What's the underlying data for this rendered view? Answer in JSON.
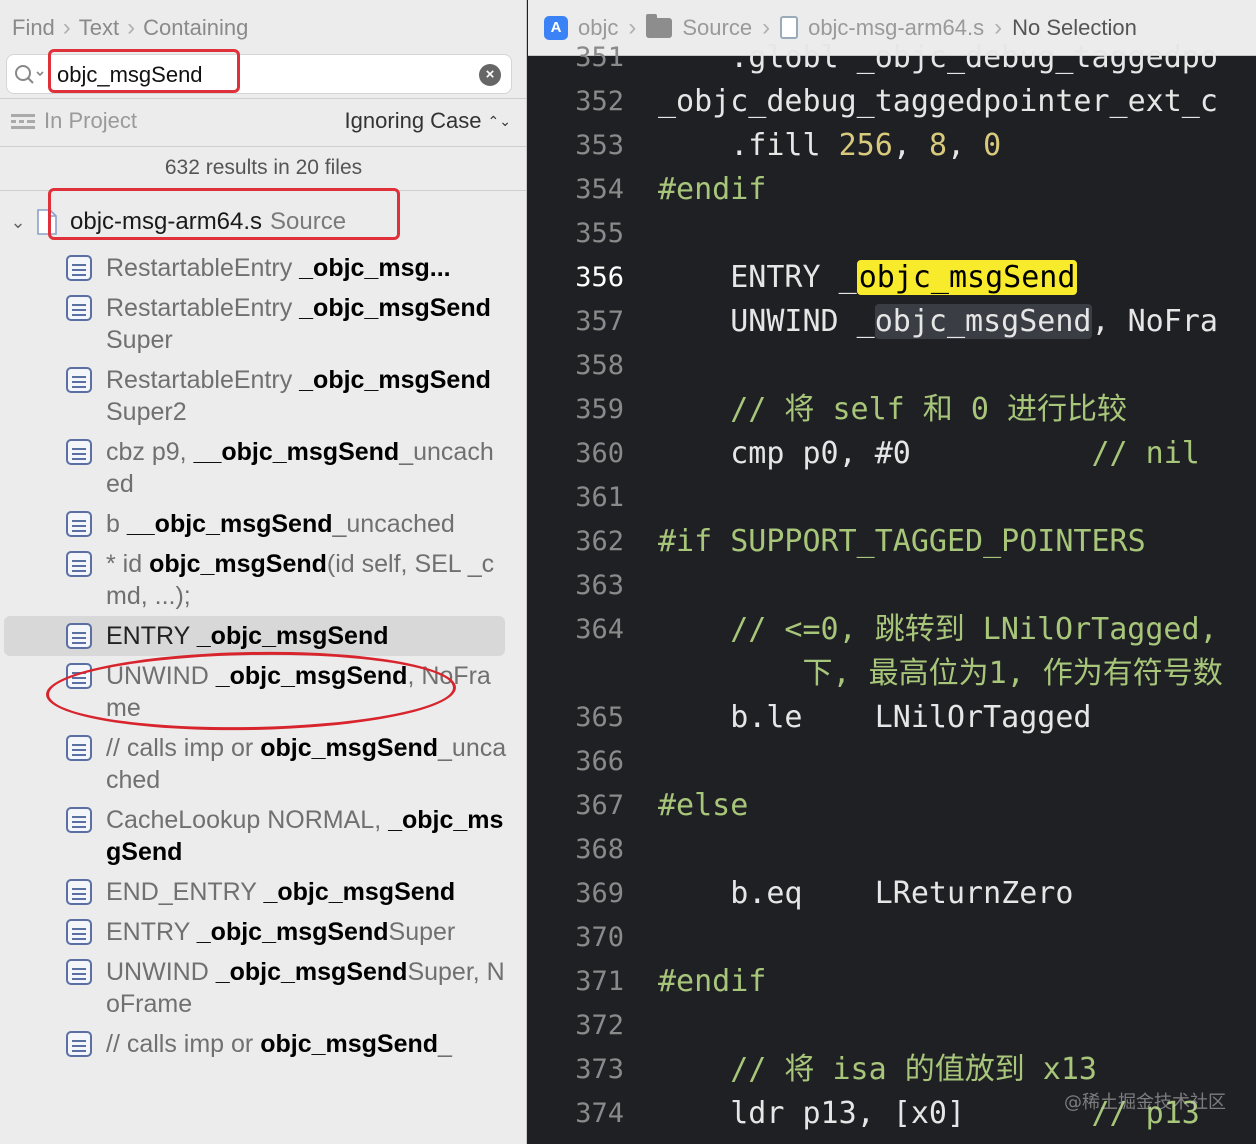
{
  "find_bar": {
    "mode": "Find",
    "kind": "Text",
    "match": "Containing"
  },
  "search": {
    "value": "objc_msgSend",
    "placeholder": ""
  },
  "scope": {
    "label": "In Project",
    "case_mode": "Ignoring Case"
  },
  "summary": "632 results in 20 files",
  "file": {
    "name": "objc-msg-arm64.s",
    "folder": "Source"
  },
  "results": [
    {
      "pre": "RestartableEntry ",
      "match": "_objc_msg...",
      "post": ""
    },
    {
      "pre": "RestartableEntry ",
      "match": "_objc_msgSend",
      "post": "Super"
    },
    {
      "pre": "RestartableEntry ",
      "match": "_objc_msgSend",
      "post": "Super2"
    },
    {
      "pre": "cbz  p9, ",
      "match": "__objc_msgSend",
      "post": "_uncached"
    },
    {
      "pre": "b      ",
      "match": "__objc_msgSend",
      "post": "_uncached"
    },
    {
      "pre": "* id ",
      "match": "objc_msgSend",
      "post": "(id self, SEL _cmd, ...);"
    },
    {
      "pre": "ENTRY ",
      "match": "_objc_msgSend",
      "post": "",
      "selected": true
    },
    {
      "pre": "UNWIND ",
      "match": "_objc_msgSend",
      "post": ", NoFrame"
    },
    {
      "pre": "// calls imp or ",
      "match": "objc_msgSend",
      "post": "_uncached"
    },
    {
      "pre": "CacheLookup NORMAL, ",
      "match": "_objc_msgSend",
      "post": ""
    },
    {
      "pre": "END_ENTRY ",
      "match": "_objc_msgSend",
      "post": ""
    },
    {
      "pre": "ENTRY ",
      "match": "_objc_msgSend",
      "post": "Super"
    },
    {
      "pre": "UNWIND ",
      "match": "_objc_msgSend",
      "post": "Super, NoFrame"
    },
    {
      "pre": "// calls imp or ",
      "match": "objc_msgSend",
      "post": "_"
    }
  ],
  "jumpbar": {
    "project": "objc",
    "folder": "Source",
    "file": "objc-msg-arm64.s",
    "selection": "No Selection"
  },
  "editor": {
    "current_line": 356,
    "lines": [
      {
        "n": "351",
        "text": "    .globl _objc_debug_taggedpo"
      },
      {
        "n": "352",
        "text": "_objc_debug_taggedpointer_ext_c"
      },
      {
        "n": "353",
        "text": "    .fill 256, 8, 0"
      },
      {
        "n": "354",
        "text": "#endif"
      },
      {
        "n": "355",
        "text": ""
      },
      {
        "n": "356",
        "text": "    ENTRY _objc_msgSend"
      },
      {
        "n": "357",
        "text": "    UNWIND _objc_msgSend, NoFra"
      },
      {
        "n": "358",
        "text": ""
      },
      {
        "n": "359",
        "text": "    // 将 self 和 0 进行比较"
      },
      {
        "n": "360",
        "text": "    cmp p0, #0          // nil"
      },
      {
        "n": "361",
        "text": ""
      },
      {
        "n": "362",
        "text": "#if SUPPORT_TAGGED_POINTERS"
      },
      {
        "n": "363",
        "text": ""
      },
      {
        "n": "364",
        "text": "    // <=0, 跳转到 LNilOrTagged,"
      },
      {
        "n": "",
        "text": "        下, 最高位为1, 作为有符号数"
      },
      {
        "n": "365",
        "text": "    b.le    LNilOrTagged"
      },
      {
        "n": "366",
        "text": ""
      },
      {
        "n": "367",
        "text": "#else"
      },
      {
        "n": "368",
        "text": ""
      },
      {
        "n": "369",
        "text": "    b.eq    LReturnZero"
      },
      {
        "n": "370",
        "text": ""
      },
      {
        "n": "371",
        "text": "#endif"
      },
      {
        "n": "372",
        "text": ""
      },
      {
        "n": "373",
        "text": "    // 将 isa 的值放到 x13"
      },
      {
        "n": "374",
        "text": "    ldr p13, [x0]       // p13"
      }
    ]
  },
  "watermark": "@稀土掘金技术社区",
  "colors": {
    "highlight": "#f8eb2b",
    "annotation_red": "#e0303a",
    "editor_bg": "#1f2024"
  }
}
